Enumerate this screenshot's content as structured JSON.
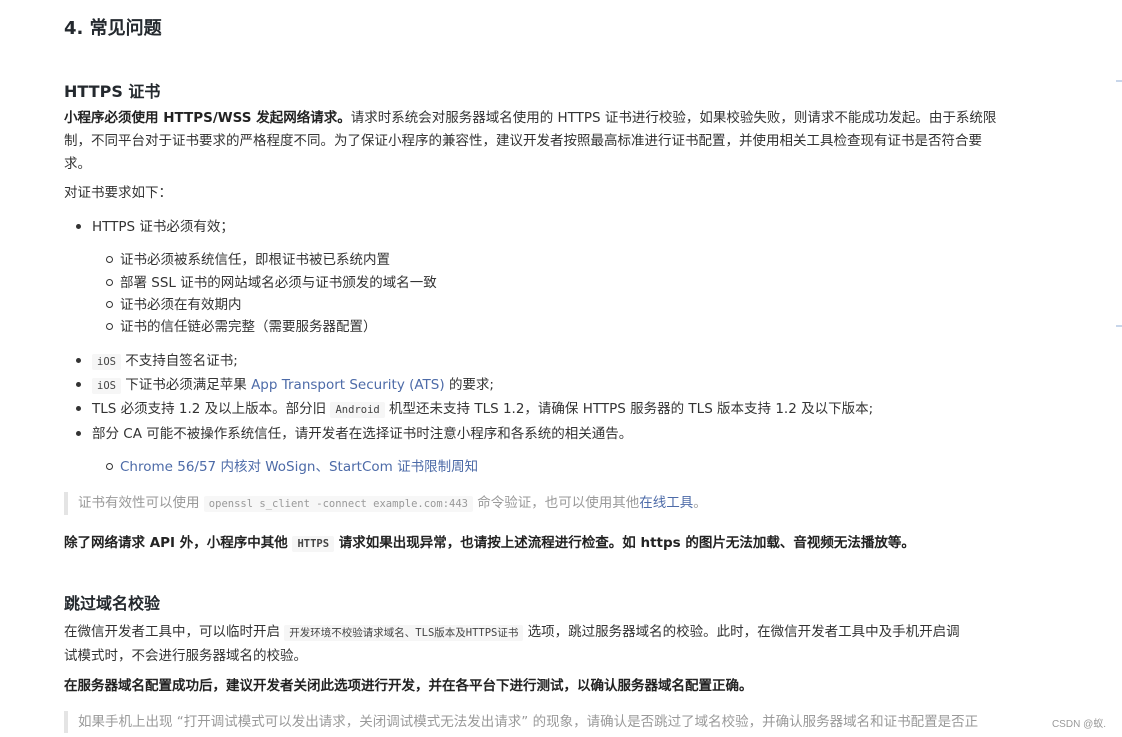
{
  "section_title": "4. 常见问题",
  "https": {
    "title": "HTTPS 证书",
    "intro_bold": "小程序必须使用 HTTPS/WSS 发起网络请求。",
    "intro_line1": "请求时系统会对服务器域名使用的 HTTPS 证书进行校验，如果校验失败，则请求不能成功发起。由于系统限",
    "intro_line2": "制，不同平台对于证书要求的严格程度不同。为了保证小程序的兼容性，建议开发者按照最高标准进行证书配置，并使用相关工具检查现有证书是否符合要",
    "intro_line3": "求。",
    "req_label": "对证书要求如下：",
    "item1": "HTTPS 证书必须有效；",
    "sub": [
      "证书必须被系统信任，即根证书被已系统内置",
      "部署 SSL 证书的网站域名必须与证书颁发的域名一致",
      "证书必须在有效期内",
      "证书的信任链必需完整（需要服务器配置）"
    ],
    "item2_code": "iOS",
    "item2_text": "不支持自签名证书;",
    "item3_code": "iOS",
    "item3_pre": "下证书必须满足苹果",
    "item3_link": "App Transport Security (ATS)",
    "item3_post": "的要求;",
    "item4_pre": "TLS 必须支持 1.2 及以上版本。部分旧",
    "item4_code": "Android",
    "item4_post": "机型还未支持 TLS 1.2，请确保 HTTPS 服务器的 TLS 版本支持 1.2 及以下版本;",
    "item5": "部分 CA 可能不被操作系统信任，请开发者在选择证书时注意小程序和各系统的相关通告。",
    "item5_sub_link": "Chrome 56/57 内核对 WoSign、StartCom 证书限制周知",
    "quote_pre": "证书有效性可以使用",
    "quote_code": "openssl s_client -connect example.com:443",
    "quote_mid": "命令验证，也可以使用其他",
    "quote_link": "在线工具",
    "quote_post": "。",
    "note_pre": "除了网络请求 API 外，小程序中其他",
    "note_code": "HTTPS",
    "note_post": "请求如果出现异常，也请按上述流程进行检查。如 https 的图片无法加载、音视频无法播放等。"
  },
  "skip": {
    "title": "跳过域名校验",
    "p1_pre": "在微信开发者工具中，可以临时开启",
    "p1_code": "开发环境不校验请求域名、TLS版本及HTTPS证书",
    "p1_post": "选项，跳过服务器域名的校验。此时，在微信开发者工具中及手机开启调",
    "p1_line2": "试模式时，不会进行服务器域名的校验。",
    "p2_bold": "在服务器域名配置成功后，建议开发者关闭此选项进行开发，并在各平台下进行测试，以确认服务器域名配置正确。",
    "quote": "如果手机上出现 “打开调试模式可以发出请求，关闭调试模式无法发出请求” 的现象，请确认是否跳过了域名校验，并确认服务器域名和证书配置是否正"
  },
  "watermark": "CSDN @蚁."
}
